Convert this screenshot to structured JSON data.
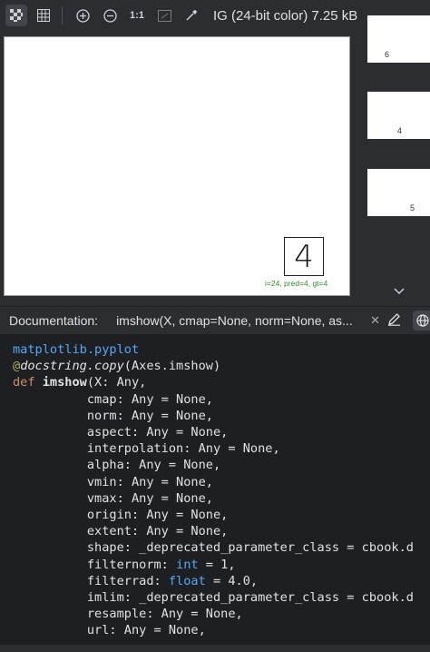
{
  "toolbar": {
    "one_to_one": "1:1",
    "file_info": "IG (24-bit color) 7.25 kB"
  },
  "image": {
    "digit": "4",
    "caption": "i=24, pred=4, gt=4"
  },
  "thumbnails": [
    "6",
    "4",
    "5"
  ],
  "documentation": {
    "label": "Documentation:",
    "tab": "imshow(X, cmap=None, norm=None, as..."
  },
  "code": {
    "module": "matplotlib.pyplot",
    "decorator_at": "@",
    "decorator": "docstring.copy",
    "decorator_args": "(Axes.imshow)",
    "def_kw": "def",
    "func_name": "imshow",
    "lines": [
      "(X: Any,",
      "          cmap: Any = None,",
      "          norm: Any = None,",
      "          aspect: Any = None,",
      "          interpolation: Any = None,",
      "          alpha: Any = None,",
      "          vmin: Any = None,",
      "          vmax: Any = None,",
      "          origin: Any = None,",
      "          extent: Any = None,",
      "          shape: _deprecated_parameter_class = cbook.d"
    ],
    "filternorm_pre": "          filternorm: ",
    "filternorm_type": "int",
    "filternorm_post": " = 1,",
    "filterrad_pre": "          filterrad: ",
    "filterrad_type": "float",
    "filterrad_post": " = 4.0,",
    "tail_lines": [
      "          imlim: _deprecated_parameter_class = cbook.d",
      "          resample: Any = None,",
      "          url: Any = None,"
    ]
  }
}
